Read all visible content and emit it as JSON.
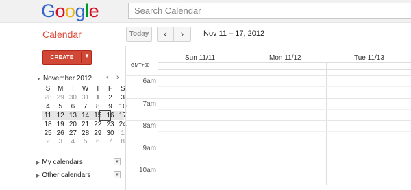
{
  "header": {
    "logo_letters": [
      {
        "ch": "G",
        "color": "#3366cc"
      },
      {
        "ch": "o",
        "color": "#d50f25"
      },
      {
        "ch": "o",
        "color": "#eeb211"
      },
      {
        "ch": "g",
        "color": "#3366cc"
      },
      {
        "ch": "l",
        "color": "#009925"
      },
      {
        "ch": "e",
        "color": "#d50f25"
      }
    ],
    "search_placeholder": "Search Calendar"
  },
  "toolbar": {
    "app_title": "Calendar",
    "today_label": "Today",
    "prev_label": "‹",
    "next_label": "›",
    "date_range": "Nov 11 – 17, 2012"
  },
  "sidebar": {
    "create_label": "CREATE",
    "create_caret": "▼",
    "mini_calendar": {
      "month_label": "November 2012",
      "prev": "‹",
      "next": "›",
      "weekdays": [
        "S",
        "M",
        "T",
        "W",
        "T",
        "F",
        "S"
      ],
      "weeks": [
        [
          "28",
          "29",
          "30",
          "31",
          "1",
          "2",
          "3"
        ],
        [
          "4",
          "5",
          "6",
          "7",
          "8",
          "9",
          "10"
        ],
        [
          "11",
          "12",
          "13",
          "14",
          "15",
          "16",
          "17"
        ],
        [
          "18",
          "19",
          "20",
          "21",
          "22",
          "23",
          "24"
        ],
        [
          "25",
          "26",
          "27",
          "28",
          "29",
          "30",
          "1"
        ],
        [
          "2",
          "3",
          "4",
          "5",
          "6",
          "7",
          "8"
        ]
      ],
      "other_month_days": "first-row first four and last two rows partial",
      "selected_week_index": 2,
      "today_week": 2,
      "today_day": 5
    },
    "my_calendars": "My calendars",
    "other_calendars": "Other calendars"
  },
  "calendar": {
    "timezone": "GMT+00",
    "days": [
      "Sun 11/11",
      "Mon 11/12",
      "Tue 11/13"
    ],
    "hours": [
      "6am",
      "7am",
      "8am",
      "9am",
      "10am"
    ]
  }
}
